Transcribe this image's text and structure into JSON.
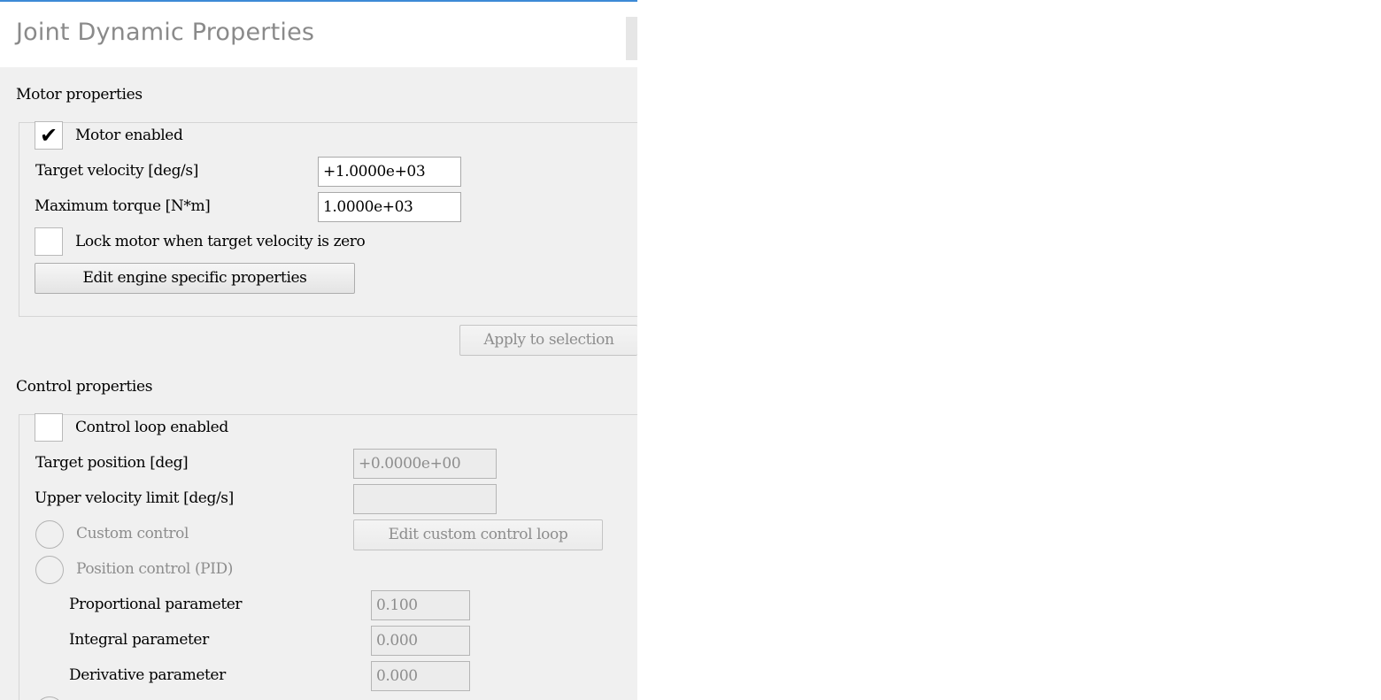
{
  "window": {
    "title": "Joint Dynamic Properties"
  },
  "motor": {
    "section_label": "Motor properties",
    "motor_enabled_label": "Motor enabled",
    "motor_enabled_checked": true,
    "target_velocity_label": "Target velocity [deg/s]",
    "target_velocity_value": "+1.0000e+03",
    "max_torque_label": "Maximum torque [N*m]",
    "max_torque_value": "1.0000e+03",
    "lock_motor_label": "Lock motor when target velocity is zero",
    "lock_motor_checked": false,
    "edit_engine_button": "Edit engine specific properties"
  },
  "apply_button": "Apply to selection",
  "control": {
    "section_label": "Control properties",
    "control_loop_label": "Control loop enabled",
    "control_loop_checked": false,
    "target_position_label": "Target position [deg]",
    "target_position_value": "+0.0000e+00",
    "upper_velocity_label": "Upper velocity limit [deg/s]",
    "upper_velocity_value": "",
    "custom_control_label": "Custom control",
    "edit_custom_button": "Edit custom control loop",
    "position_control_label": "Position control (PID)",
    "proportional_label": "Proportional parameter",
    "proportional_value": "0.100",
    "integral_label": "Integral parameter",
    "integral_value": "0.000",
    "derivative_label": "Derivative parameter",
    "derivative_value": "0.000"
  }
}
